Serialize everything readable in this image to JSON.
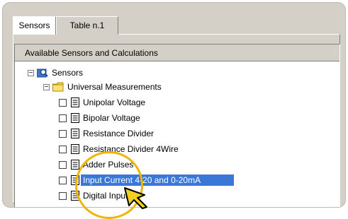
{
  "tabs": [
    {
      "label": "Sensors",
      "active": true
    },
    {
      "label": "Table n.1",
      "active": false
    }
  ],
  "group": {
    "title": "Available Sensors and Calculations"
  },
  "tree": {
    "root": {
      "label": "Sensors",
      "expander": "−",
      "icon": "search-icon"
    },
    "folder": {
      "label": "Universal Measurements",
      "expander": "−",
      "icon": "folder-icon"
    },
    "items": [
      {
        "label": "Unipolar Voltage",
        "checked": false,
        "selected": false
      },
      {
        "label": "Bipolar Voltage",
        "checked": false,
        "selected": false
      },
      {
        "label": "Resistance Divider",
        "checked": false,
        "selected": false
      },
      {
        "label": "Resistance Divider 4Wire",
        "checked": false,
        "selected": false
      },
      {
        "label": "Adder Pulses",
        "checked": false,
        "selected": false
      },
      {
        "label": "Input Current 4-20 and 0-20mA",
        "checked": false,
        "selected": true
      },
      {
        "label": "Digital Input",
        "checked": false,
        "selected": false
      }
    ]
  },
  "colors": {
    "selection": "#3a78d8",
    "highlight_ring": "#f0b400",
    "window": "#d4d0c8"
  }
}
